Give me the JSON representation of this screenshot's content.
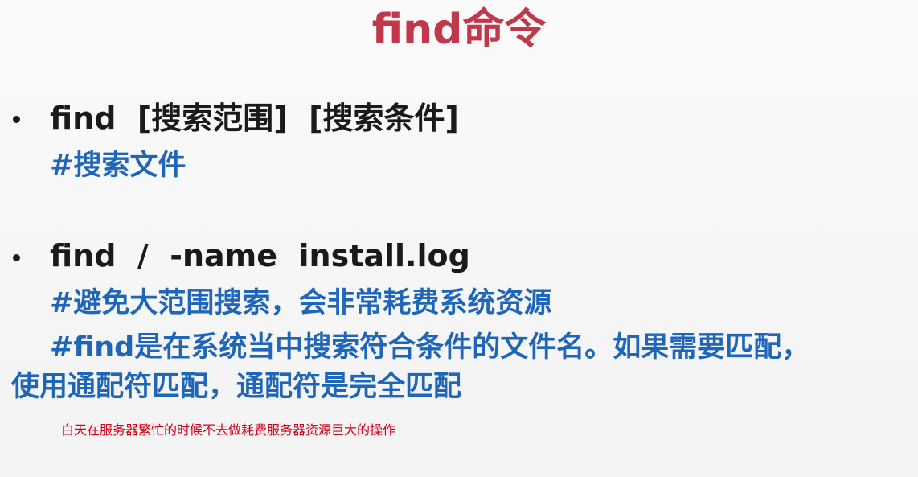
{
  "slide": {
    "title": "find命令",
    "item1": {
      "command": "find  [搜索范围]  [搜索条件]",
      "comment": "#搜索文件"
    },
    "item2": {
      "command": "find  /  -name  install.log",
      "comment1": "#避免大范围搜索，会非常耗费系统资源",
      "comment2_line1": "#find是在系统当中搜索符合条件的文件名。如果需要匹配，",
      "comment2_line2": "使用通配符匹配，通配符是完全匹配"
    },
    "note": "白天在服务器繁忙的时候不去做耗费服务器资源巨大的操作"
  }
}
